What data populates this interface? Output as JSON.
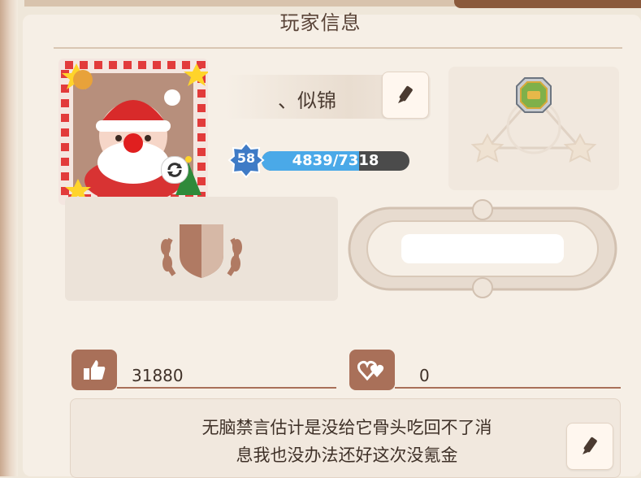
{
  "title": "玩家信息",
  "player": {
    "name": "、似锦",
    "level": "58",
    "exp_text": "4839/7318",
    "exp_fraction": 0.661
  },
  "stats": {
    "likes": "31880",
    "hearts": "0"
  },
  "signature": {
    "line1": "无脑禁言估计是没给它骨头吃回不了消",
    "line2": "息我也没办法还好这次没氪金"
  },
  "icons": {
    "edit": "pencil-icon",
    "refresh": "refresh-icon",
    "like": "thumbs-up-icon",
    "heart": "hearts-icon",
    "crest": "laurel-shield-icon",
    "medal": "octagon-medal-icon"
  },
  "colors": {
    "accent_brown": "#a97059",
    "exp_blue": "#4aa9e8",
    "bar_dark": "#4b4b4b"
  }
}
